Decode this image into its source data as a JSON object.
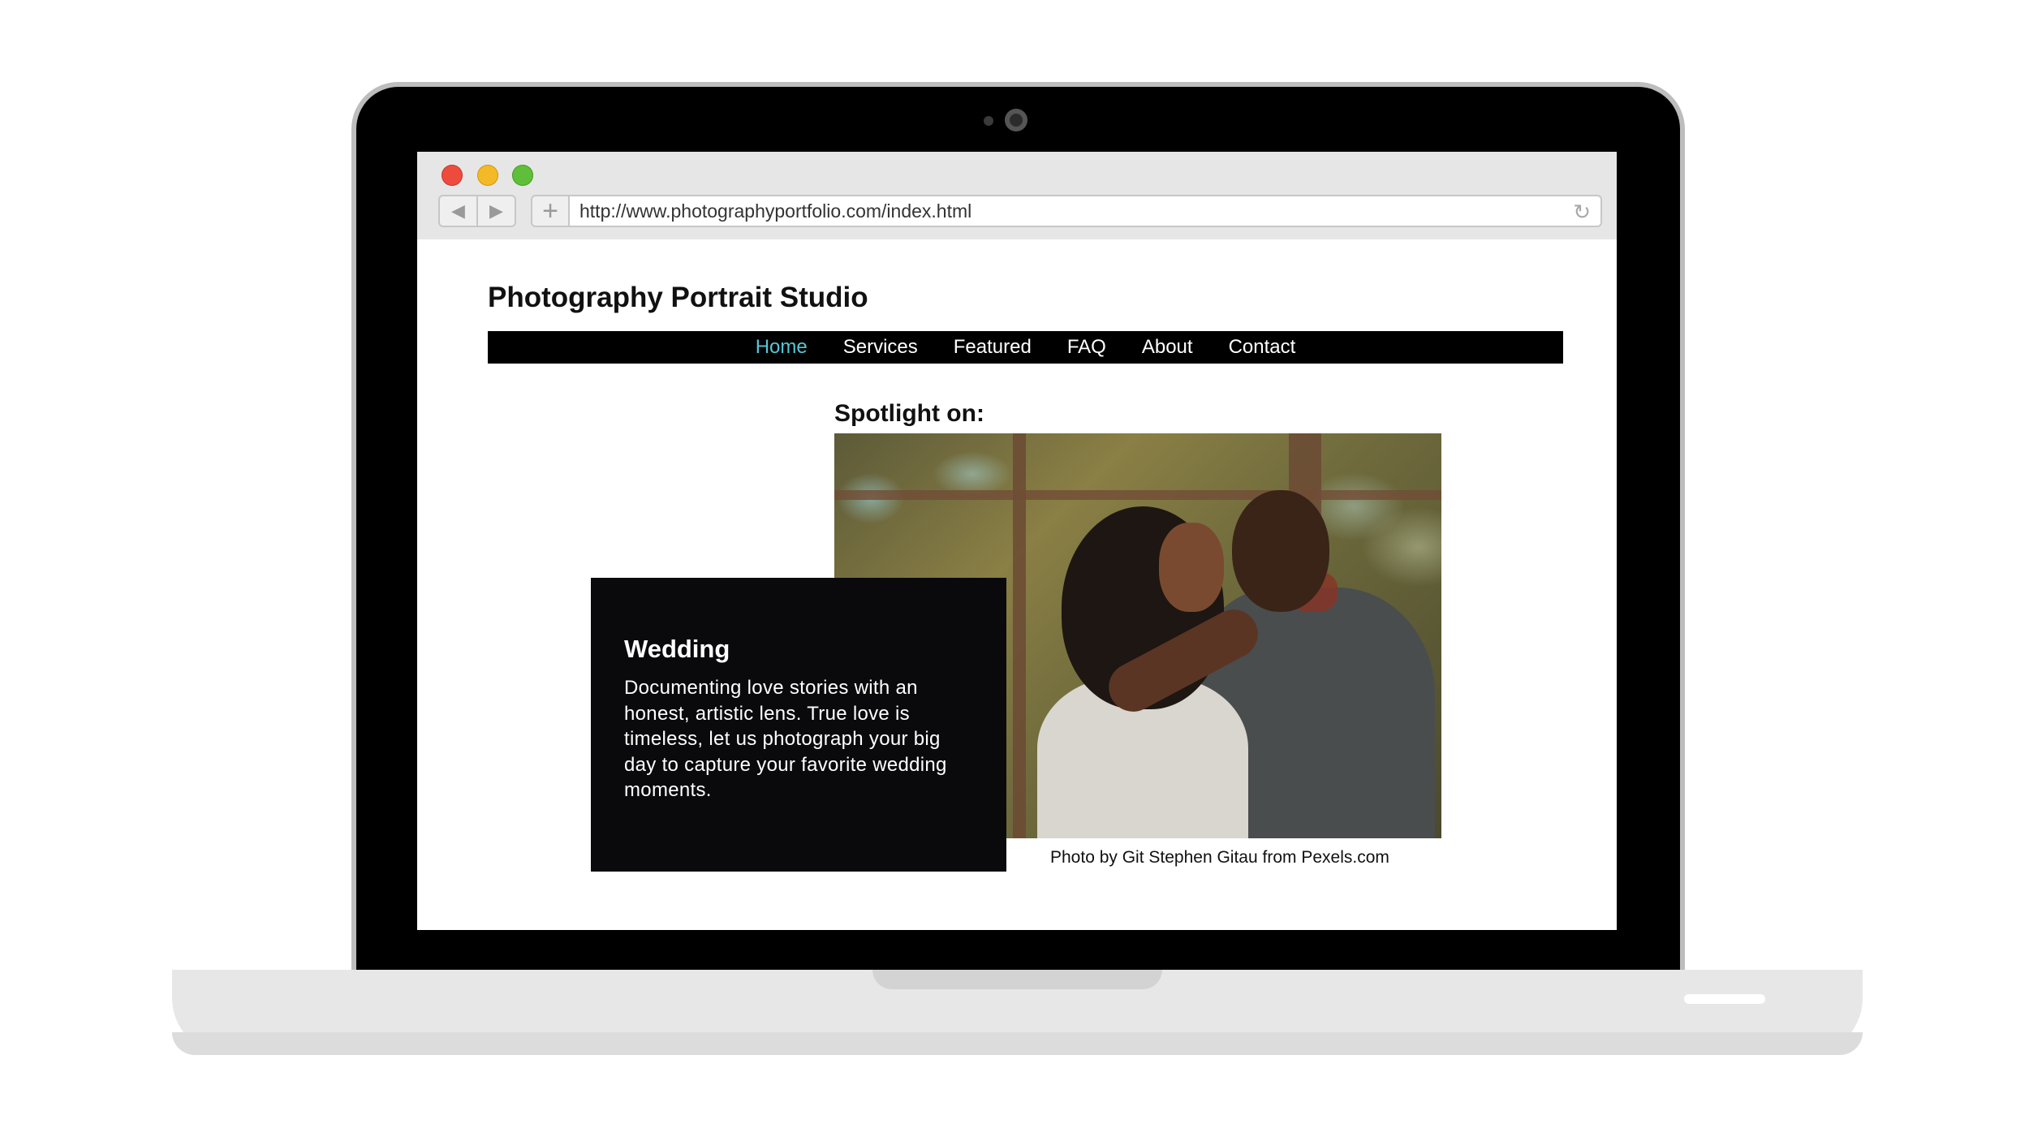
{
  "browser": {
    "url": "http://www.photographyportfolio.com/index.html",
    "back_glyph": "◀",
    "forward_glyph": "▶",
    "new_tab_glyph": "+",
    "reload_glyph": "↻"
  },
  "site": {
    "title": "Photography Portrait Studio",
    "nav": [
      {
        "label": "Home",
        "active": true
      },
      {
        "label": "Services",
        "active": false
      },
      {
        "label": "Featured",
        "active": false
      },
      {
        "label": "FAQ",
        "active": false
      },
      {
        "label": "About",
        "active": false
      },
      {
        "label": "Contact",
        "active": false
      }
    ],
    "nav_active_color": "#57c6d6"
  },
  "spotlight": {
    "heading": "Spotlight on:",
    "card_title": "Wedding",
    "card_text": "Documenting love stories with an honest, artistic lens. True love is timeless, let us photograph your big day to capture your favorite wedding moments.",
    "photo_credit": "Photo by Git Stephen Gitau from Pexels.com"
  },
  "colors": {
    "window_close": "#ee4b3f",
    "window_minimize": "#f4b927",
    "window_maximize": "#5fbf3a"
  }
}
